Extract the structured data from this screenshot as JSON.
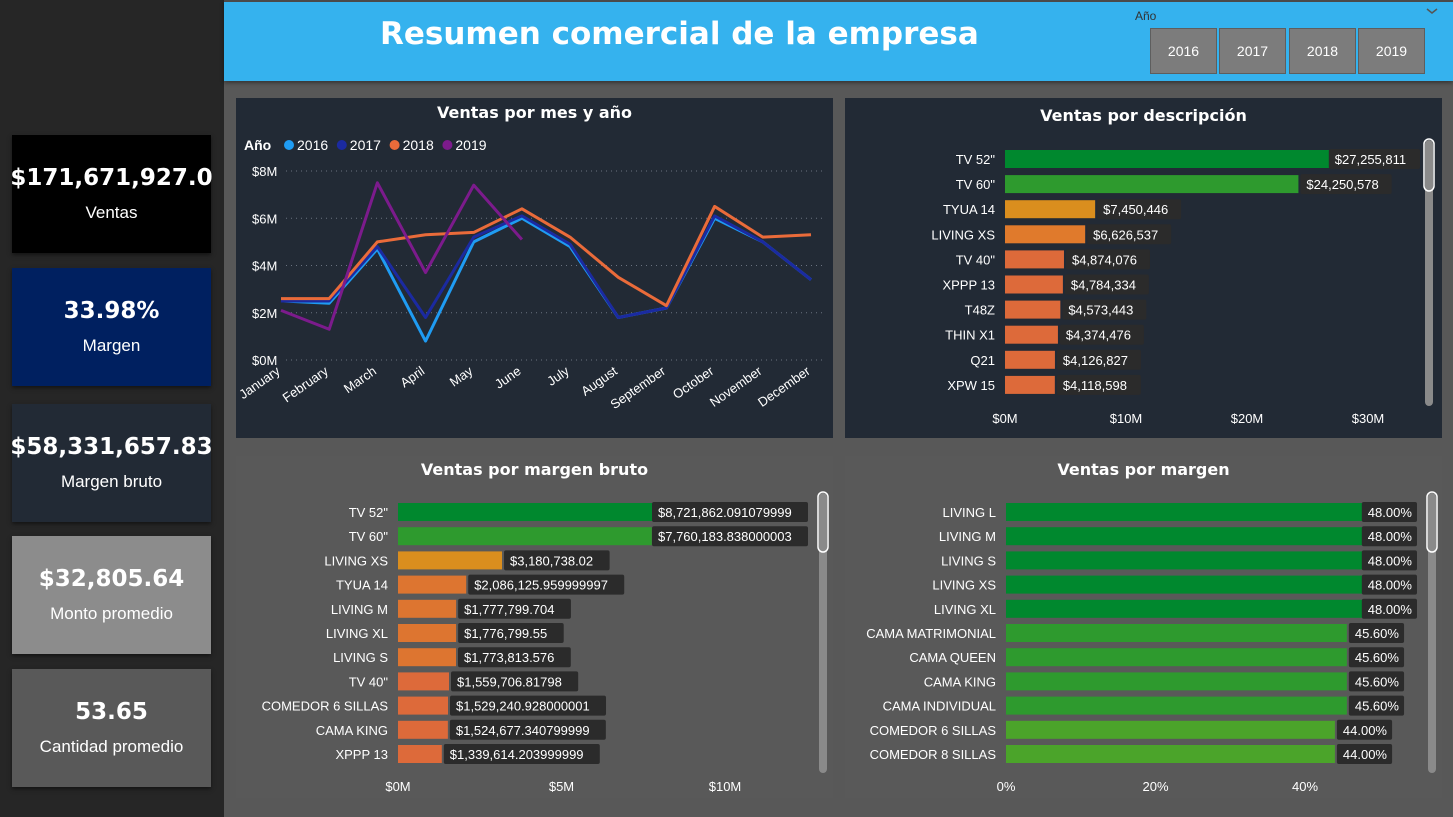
{
  "header": {
    "title": "Resumen comercial de la empresa",
    "slicer": {
      "title": "Año",
      "options": [
        "2016",
        "2017",
        "2018",
        "2019"
      ]
    }
  },
  "kpis": [
    {
      "value": "$171,671,927.0",
      "label": "Ventas",
      "bg": "#000000"
    },
    {
      "value": "33.98%",
      "label": "Margen",
      "bg": "#002060"
    },
    {
      "value": "$58,331,657.83",
      "label": "Margen bruto",
      "bg": "#222a35"
    },
    {
      "value": "$32,805.64",
      "label": "Monto promedio",
      "bg": "#8c8c8c"
    },
    {
      "value": "53.65",
      "label": "Cantidad promedio",
      "bg": "#595959"
    }
  ],
  "colors": {
    "panel_dark": "#222a35",
    "panel_gray": "#595959",
    "bar_green": "#00882e",
    "bar_green2": "#2e9a2e",
    "bar_green3": "#4ba42a",
    "bar_yellow": "#da8e1e",
    "bar_orange": "#dd7530",
    "label_bg": "#2b2b2b"
  },
  "chart_data": [
    {
      "type": "line",
      "title": "Ventas por mes y año",
      "legend": {
        "title": "Año",
        "placement": "top-left"
      },
      "categories": [
        "January",
        "February",
        "March",
        "April",
        "May",
        "June",
        "July",
        "August",
        "September",
        "October",
        "November",
        "December"
      ],
      "yticks": [
        "$0M",
        "$2M",
        "$4M",
        "$6M",
        "$8M"
      ],
      "ylim": [
        0,
        8
      ],
      "grid": true,
      "series": [
        {
          "name": "2016",
          "color": "#1f9cf3",
          "values": [
            2.5,
            2.4,
            4.7,
            0.8,
            5.0,
            6.0,
            4.8,
            1.8,
            2.2,
            6.0,
            5.0,
            3.4
          ]
        },
        {
          "name": "2017",
          "color": "#1b2aa0",
          "values": [
            2.5,
            2.5,
            4.8,
            1.8,
            5.2,
            6.1,
            4.9,
            1.8,
            2.2,
            6.1,
            5.0,
            3.4
          ]
        },
        {
          "name": "2018",
          "color": "#ea6b3a",
          "values": [
            2.6,
            2.6,
            5.0,
            5.3,
            5.4,
            6.4,
            5.2,
            3.5,
            2.3,
            6.5,
            5.2,
            5.3
          ]
        },
        {
          "name": "2019",
          "color": "#7c1b8c",
          "values": [
            2.1,
            1.3,
            7.5,
            3.7,
            7.4,
            5.1
          ]
        }
      ]
    },
    {
      "type": "bar",
      "title": "Ventas por descripción",
      "categories": [
        "TV 52\"",
        "TV 60\"",
        "TYUA 14",
        "LIVING XS",
        "TV 40\"",
        "XPPP 13",
        "T48Z",
        "THIN X1",
        "Q21",
        "XPW 15"
      ],
      "values": [
        27255811,
        24250578,
        7450446,
        6626537,
        4874076,
        4784334,
        4573443,
        4374476,
        4126827,
        4118598
      ],
      "labels": [
        "$27,255,811",
        "$24,250,578",
        "$7,450,446",
        "$6,626,537",
        "$4,874,076",
        "$4,784,334",
        "$4,573,443",
        "$4,374,476",
        "$4,126,827",
        "$4,118,598"
      ],
      "colors": [
        "#00882e",
        "#2e9a2e",
        "#da8e1e",
        "#e07a2c",
        "#dd6a3a",
        "#dd6a3a",
        "#dd6a3a",
        "#dd6a3a",
        "#dd6a3a",
        "#dd6a3a"
      ],
      "xticks": [
        "$0M",
        "$10M",
        "$20M",
        "$30M"
      ],
      "xlim": [
        0,
        30000000
      ]
    },
    {
      "type": "bar",
      "title": "Ventas por margen bruto",
      "categories": [
        "TV 52\"",
        "TV 60\"",
        "LIVING XS",
        "TYUA 14",
        "LIVING M",
        "LIVING XL",
        "LIVING S",
        "TV 40\"",
        "COMEDOR 6 SILLAS",
        "CAMA KING",
        "XPPP 13"
      ],
      "values": [
        8721862.091079999,
        7760183.838000003,
        3180738.02,
        2086125.959999997,
        1777799.704,
        1776799.55,
        1773813.576,
        1559706.81798,
        1529240.928000001,
        1524677.340799999,
        1339614.203999999
      ],
      "labels": [
        "$8,721,862.091079999",
        "$7,760,183.838000003",
        "$3,180,738.02",
        "$2,086,125.959999997",
        "$1,777,799.704",
        "$1,776,799.55",
        "$1,773,813.576",
        "$1,559,706.81798",
        "$1,529,240.928000001",
        "$1,524,677.340799999",
        "$1,339,614.203999999"
      ],
      "colors": [
        "#00882e",
        "#2e9a2e",
        "#da8e1e",
        "#dd7530",
        "#dd7530",
        "#dd7530",
        "#dd7530",
        "#dd6a3a",
        "#dd6a3a",
        "#dd6a3a",
        "#dd6a3a"
      ],
      "xticks": [
        "$0M",
        "$5M",
        "$10M"
      ],
      "xlim": [
        0,
        10000000
      ]
    },
    {
      "type": "bar",
      "title": "Ventas por margen",
      "categories": [
        "LIVING L",
        "LIVING M",
        "LIVING S",
        "LIVING XS",
        "LIVING XL",
        "CAMA MATRIMONIAL",
        "CAMA QUEEN",
        "CAMA KING",
        "CAMA INDIVIDUAL",
        "COMEDOR 6 SILLAS",
        "COMEDOR 8 SILLAS"
      ],
      "values": [
        48.0,
        48.0,
        48.0,
        48.0,
        48.0,
        45.6,
        45.6,
        45.6,
        45.6,
        44.0,
        44.0
      ],
      "labels": [
        "48.00%",
        "48.00%",
        "48.00%",
        "48.00%",
        "48.00%",
        "45.60%",
        "45.60%",
        "45.60%",
        "45.60%",
        "44.00%",
        "44.00%"
      ],
      "colors": [
        "#00882e",
        "#00882e",
        "#00882e",
        "#00882e",
        "#00882e",
        "#2e9a2e",
        "#2e9a2e",
        "#2e9a2e",
        "#2e9a2e",
        "#4ba42a",
        "#4ba42a"
      ],
      "xticks": [
        "0%",
        "20%",
        "40%"
      ],
      "xlim": [
        0,
        40
      ]
    }
  ]
}
